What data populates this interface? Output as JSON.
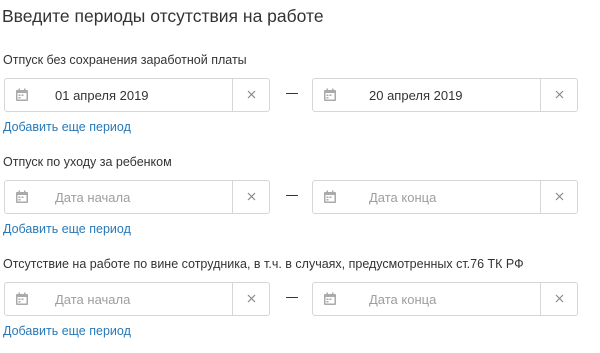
{
  "page": {
    "title": "Введите периоды отсутствия на работе"
  },
  "sections": [
    {
      "label": "Отпуск без сохранения заработной платы",
      "start": {
        "value": "01 апреля 2019",
        "placeholder": "Дата начала"
      },
      "end": {
        "value": "20 апреля 2019",
        "placeholder": "Дата конца"
      },
      "add_link": "Добавить еще период"
    },
    {
      "label": "Отпуск по уходу за ребенком",
      "start": {
        "value": "",
        "placeholder": "Дата начала"
      },
      "end": {
        "value": "",
        "placeholder": "Дата конца"
      },
      "add_link": "Добавить еще период"
    },
    {
      "label": "Отсутствие на работе по вине сотрудника, в т.ч. в случаях, предусмотренных ст.76 ТК РФ",
      "start": {
        "value": "",
        "placeholder": "Дата начала"
      },
      "end": {
        "value": "",
        "placeholder": "Дата конца"
      },
      "add_link": "Добавить еще период"
    }
  ],
  "icons": {
    "calendar": "calendar-icon",
    "clear": "close-icon"
  },
  "colors": {
    "text": "#333333",
    "placeholder": "#9e9e9e",
    "link": "#2979b8",
    "border": "#d6d6d6",
    "icon": "#aaaaaa"
  }
}
